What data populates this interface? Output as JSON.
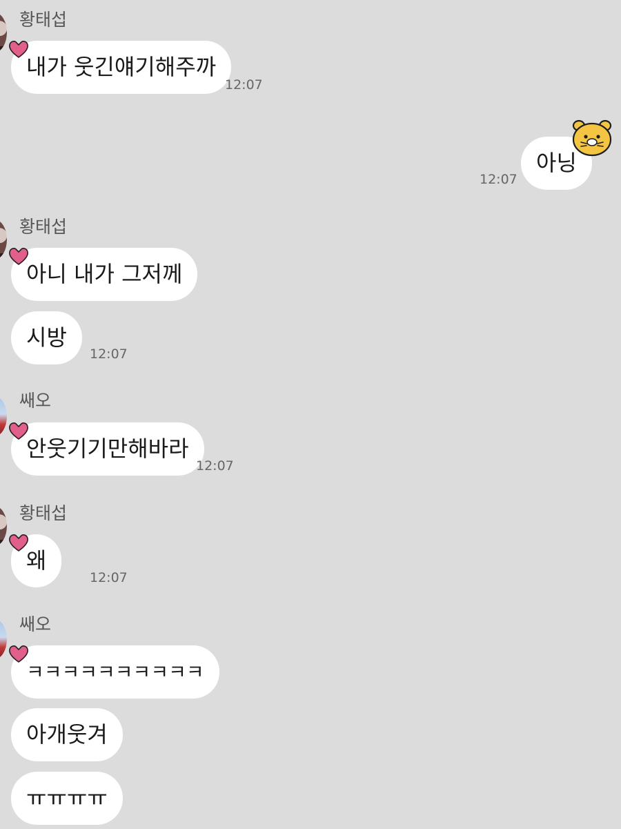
{
  "chat": {
    "messages": [
      {
        "sender": "황태섭",
        "text": "내가 웃긴얘기해주까",
        "time": "12:07"
      },
      {
        "sender": "me",
        "text": "아닝",
        "time": "12:07"
      },
      {
        "sender": "황태섭",
        "text": "아니 내가 그저께"
      },
      {
        "sender": "황태섭",
        "text": "시방",
        "time": "12:07"
      },
      {
        "sender": "쌔오",
        "text": "안웃기기만해바라",
        "time": "12:07"
      },
      {
        "sender": "황태섭",
        "text": "왜",
        "time": "12:07"
      },
      {
        "sender": "쌔오",
        "text": "ㅋㅋㅋㅋㅋㅋㅋㅋㅋㅋ"
      },
      {
        "sender": "쌔오",
        "text": "아개웃겨"
      },
      {
        "sender": "쌔오",
        "text": "ㅠㅠㅠㅠ"
      }
    ]
  },
  "icons": {
    "reaction": "heart-icon",
    "sticker": "bear-sticker-icon"
  },
  "colors": {
    "background": "#dcdcdc",
    "bubble": "#ffffff",
    "heart": "#e0608a"
  }
}
